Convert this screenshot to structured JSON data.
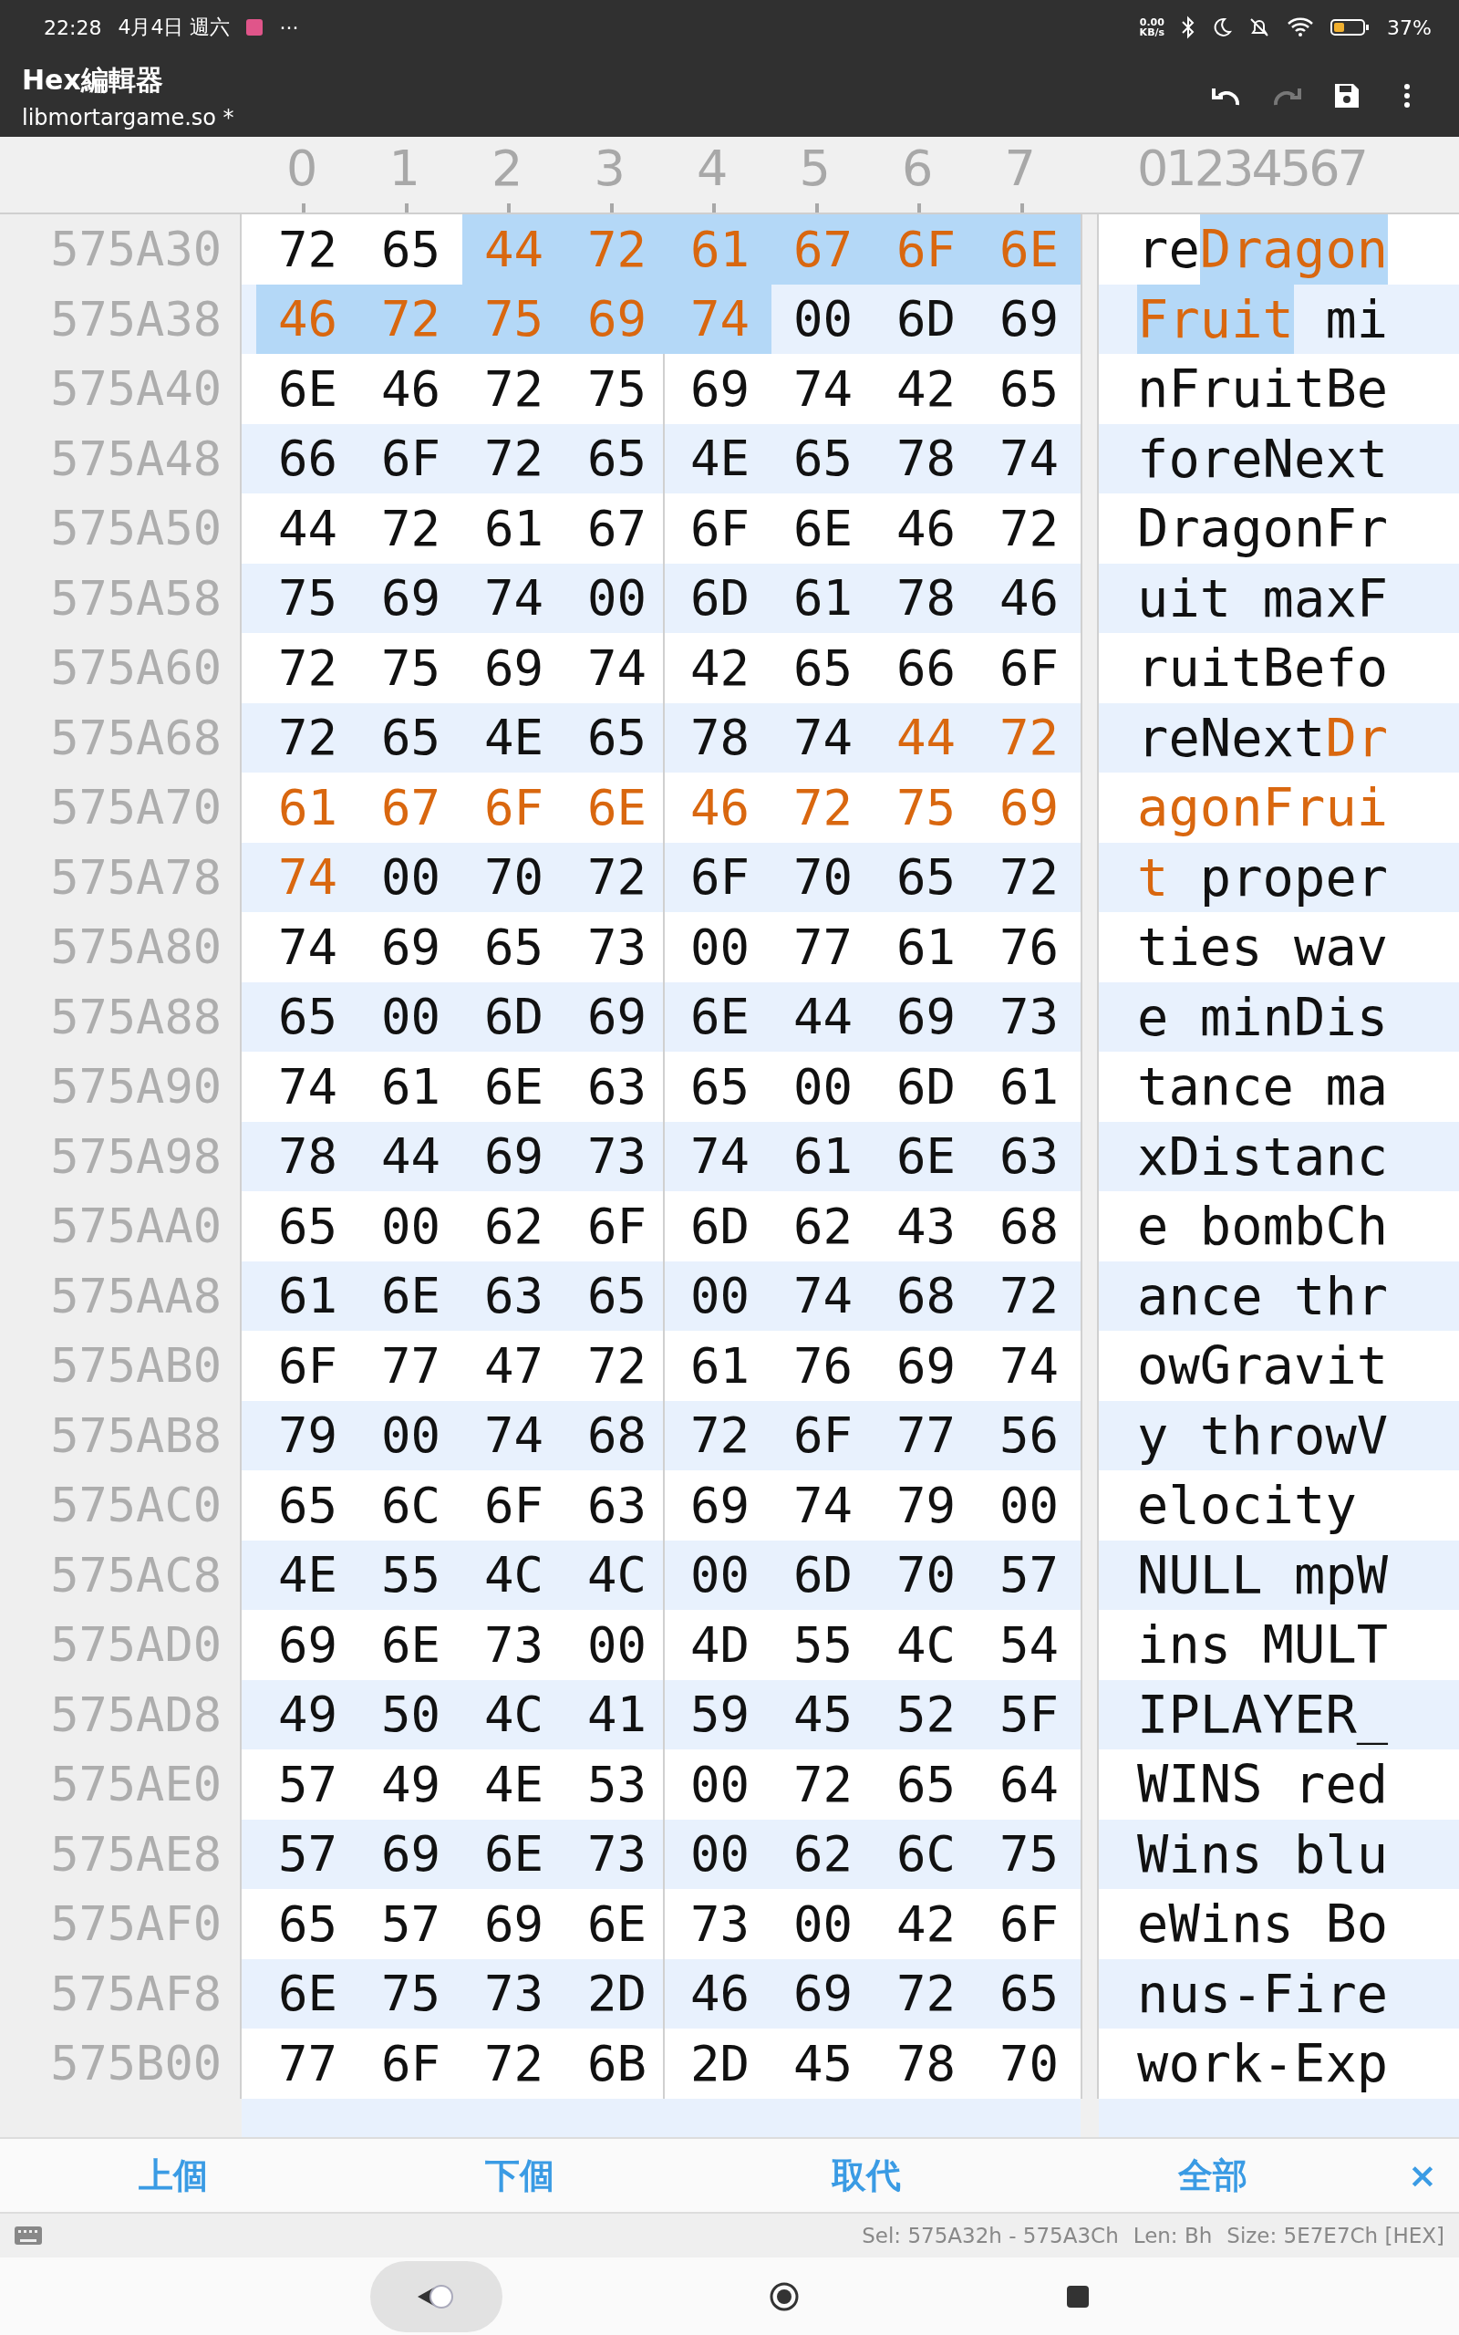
{
  "status_bar": {
    "time": "22:28",
    "date": "4月4日 週六",
    "more": "···",
    "speed": [
      "0.00",
      "KB/s"
    ],
    "battery": "37%"
  },
  "app_bar": {
    "title": "Hex編輯器",
    "subtitle": "libmortargame.so *",
    "redo_disabled": true
  },
  "header": {
    "columns": [
      "0",
      "1",
      "2",
      "3",
      "4",
      "5",
      "6",
      "7"
    ],
    "ascii": "01234567"
  },
  "rows": [
    {
      "offset": "575A30",
      "ascii": "reDragon",
      "bytes": [
        {
          "hex": "72",
          "match": false,
          "selected": false
        },
        {
          "hex": "65",
          "match": false,
          "selected": false
        },
        {
          "hex": "44",
          "match": true,
          "selected": true
        },
        {
          "hex": "72",
          "match": true,
          "selected": true
        },
        {
          "hex": "61",
          "match": true,
          "selected": true
        },
        {
          "hex": "67",
          "match": true,
          "selected": true
        },
        {
          "hex": "6F",
          "match": true,
          "selected": true
        },
        {
          "hex": "6E",
          "match": true,
          "selected": true
        }
      ]
    },
    {
      "offset": "575A38",
      "ascii": "Fruit mi",
      "bytes": [
        {
          "hex": "46",
          "match": true,
          "selected": true
        },
        {
          "hex": "72",
          "match": true,
          "selected": true
        },
        {
          "hex": "75",
          "match": true,
          "selected": true
        },
        {
          "hex": "69",
          "match": true,
          "selected": true
        },
        {
          "hex": "74",
          "match": true,
          "selected": true
        },
        {
          "hex": "00",
          "match": false,
          "selected": false
        },
        {
          "hex": "6D",
          "match": false,
          "selected": false
        },
        {
          "hex": "69",
          "match": false,
          "selected": false
        }
      ]
    },
    {
      "offset": "575A40",
      "ascii": "nFruitBe",
      "bytes": [
        {
          "hex": "6E",
          "match": false,
          "selected": false
        },
        {
          "hex": "46",
          "match": false,
          "selected": false
        },
        {
          "hex": "72",
          "match": false,
          "selected": false
        },
        {
          "hex": "75",
          "match": false,
          "selected": false
        },
        {
          "hex": "69",
          "match": false,
          "selected": false
        },
        {
          "hex": "74",
          "match": false,
          "selected": false
        },
        {
          "hex": "42",
          "match": false,
          "selected": false
        },
        {
          "hex": "65",
          "match": false,
          "selected": false
        }
      ]
    },
    {
      "offset": "575A48",
      "ascii": "foreNext",
      "bytes": [
        {
          "hex": "66",
          "match": false,
          "selected": false
        },
        {
          "hex": "6F",
          "match": false,
          "selected": false
        },
        {
          "hex": "72",
          "match": false,
          "selected": false
        },
        {
          "hex": "65",
          "match": false,
          "selected": false
        },
        {
          "hex": "4E",
          "match": false,
          "selected": false
        },
        {
          "hex": "65",
          "match": false,
          "selected": false
        },
        {
          "hex": "78",
          "match": false,
          "selected": false
        },
        {
          "hex": "74",
          "match": false,
          "selected": false
        }
      ]
    },
    {
      "offset": "575A50",
      "ascii": "DragonFr",
      "bytes": [
        {
          "hex": "44",
          "match": false,
          "selected": false
        },
        {
          "hex": "72",
          "match": false,
          "selected": false
        },
        {
          "hex": "61",
          "match": false,
          "selected": false
        },
        {
          "hex": "67",
          "match": false,
          "selected": false
        },
        {
          "hex": "6F",
          "match": false,
          "selected": false
        },
        {
          "hex": "6E",
          "match": false,
          "selected": false
        },
        {
          "hex": "46",
          "match": false,
          "selected": false
        },
        {
          "hex": "72",
          "match": false,
          "selected": false
        }
      ]
    },
    {
      "offset": "575A58",
      "ascii": "uit maxF",
      "bytes": [
        {
          "hex": "75",
          "match": false,
          "selected": false
        },
        {
          "hex": "69",
          "match": false,
          "selected": false
        },
        {
          "hex": "74",
          "match": false,
          "selected": false
        },
        {
          "hex": "00",
          "match": false,
          "selected": false
        },
        {
          "hex": "6D",
          "match": false,
          "selected": false
        },
        {
          "hex": "61",
          "match": false,
          "selected": false
        },
        {
          "hex": "78",
          "match": false,
          "selected": false
        },
        {
          "hex": "46",
          "match": false,
          "selected": false
        }
      ]
    },
    {
      "offset": "575A60",
      "ascii": "ruitBefo",
      "bytes": [
        {
          "hex": "72",
          "match": false,
          "selected": false
        },
        {
          "hex": "75",
          "match": false,
          "selected": false
        },
        {
          "hex": "69",
          "match": false,
          "selected": false
        },
        {
          "hex": "74",
          "match": false,
          "selected": false
        },
        {
          "hex": "42",
          "match": false,
          "selected": false
        },
        {
          "hex": "65",
          "match": false,
          "selected": false
        },
        {
          "hex": "66",
          "match": false,
          "selected": false
        },
        {
          "hex": "6F",
          "match": false,
          "selected": false
        }
      ]
    },
    {
      "offset": "575A68",
      "ascii": "reNextDr",
      "bytes": [
        {
          "hex": "72",
          "match": false,
          "selected": false
        },
        {
          "hex": "65",
          "match": false,
          "selected": false
        },
        {
          "hex": "4E",
          "match": false,
          "selected": false
        },
        {
          "hex": "65",
          "match": false,
          "selected": false
        },
        {
          "hex": "78",
          "match": false,
          "selected": false
        },
        {
          "hex": "74",
          "match": false,
          "selected": false
        },
        {
          "hex": "44",
          "match": true,
          "selected": false
        },
        {
          "hex": "72",
          "match": true,
          "selected": false
        }
      ]
    },
    {
      "offset": "575A70",
      "ascii": "agonFrui",
      "bytes": [
        {
          "hex": "61",
          "match": true,
          "selected": false
        },
        {
          "hex": "67",
          "match": true,
          "selected": false
        },
        {
          "hex": "6F",
          "match": true,
          "selected": false
        },
        {
          "hex": "6E",
          "match": true,
          "selected": false
        },
        {
          "hex": "46",
          "match": true,
          "selected": false
        },
        {
          "hex": "72",
          "match": true,
          "selected": false
        },
        {
          "hex": "75",
          "match": true,
          "selected": false
        },
        {
          "hex": "69",
          "match": true,
          "selected": false
        }
      ]
    },
    {
      "offset": "575A78",
      "ascii": "t proper",
      "bytes": [
        {
          "hex": "74",
          "match": true,
          "selected": false
        },
        {
          "hex": "00",
          "match": false,
          "selected": false
        },
        {
          "hex": "70",
          "match": false,
          "selected": false
        },
        {
          "hex": "72",
          "match": false,
          "selected": false
        },
        {
          "hex": "6F",
          "match": false,
          "selected": false
        },
        {
          "hex": "70",
          "match": false,
          "selected": false
        },
        {
          "hex": "65",
          "match": false,
          "selected": false
        },
        {
          "hex": "72",
          "match": false,
          "selected": false
        }
      ]
    },
    {
      "offset": "575A80",
      "ascii": "ties wav",
      "bytes": [
        {
          "hex": "74",
          "match": false,
          "selected": false
        },
        {
          "hex": "69",
          "match": false,
          "selected": false
        },
        {
          "hex": "65",
          "match": false,
          "selected": false
        },
        {
          "hex": "73",
          "match": false,
          "selected": false
        },
        {
          "hex": "00",
          "match": false,
          "selected": false
        },
        {
          "hex": "77",
          "match": false,
          "selected": false
        },
        {
          "hex": "61",
          "match": false,
          "selected": false
        },
        {
          "hex": "76",
          "match": false,
          "selected": false
        }
      ]
    },
    {
      "offset": "575A88",
      "ascii": "e minDis",
      "bytes": [
        {
          "hex": "65",
          "match": false,
          "selected": false
        },
        {
          "hex": "00",
          "match": false,
          "selected": false
        },
        {
          "hex": "6D",
          "match": false,
          "selected": false
        },
        {
          "hex": "69",
          "match": false,
          "selected": false
        },
        {
          "hex": "6E",
          "match": false,
          "selected": false
        },
        {
          "hex": "44",
          "match": false,
          "selected": false
        },
        {
          "hex": "69",
          "match": false,
          "selected": false
        },
        {
          "hex": "73",
          "match": false,
          "selected": false
        }
      ]
    },
    {
      "offset": "575A90",
      "ascii": "tance ma",
      "bytes": [
        {
          "hex": "74",
          "match": false,
          "selected": false
        },
        {
          "hex": "61",
          "match": false,
          "selected": false
        },
        {
          "hex": "6E",
          "match": false,
          "selected": false
        },
        {
          "hex": "63",
          "match": false,
          "selected": false
        },
        {
          "hex": "65",
          "match": false,
          "selected": false
        },
        {
          "hex": "00",
          "match": false,
          "selected": false
        },
        {
          "hex": "6D",
          "match": false,
          "selected": false
        },
        {
          "hex": "61",
          "match": false,
          "selected": false
        }
      ]
    },
    {
      "offset": "575A98",
      "ascii": "xDistanc",
      "bytes": [
        {
          "hex": "78",
          "match": false,
          "selected": false
        },
        {
          "hex": "44",
          "match": false,
          "selected": false
        },
        {
          "hex": "69",
          "match": false,
          "selected": false
        },
        {
          "hex": "73",
          "match": false,
          "selected": false
        },
        {
          "hex": "74",
          "match": false,
          "selected": false
        },
        {
          "hex": "61",
          "match": false,
          "selected": false
        },
        {
          "hex": "6E",
          "match": false,
          "selected": false
        },
        {
          "hex": "63",
          "match": false,
          "selected": false
        }
      ]
    },
    {
      "offset": "575AA0",
      "ascii": "e bombCh",
      "bytes": [
        {
          "hex": "65",
          "match": false,
          "selected": false
        },
        {
          "hex": "00",
          "match": false,
          "selected": false
        },
        {
          "hex": "62",
          "match": false,
          "selected": false
        },
        {
          "hex": "6F",
          "match": false,
          "selected": false
        },
        {
          "hex": "6D",
          "match": false,
          "selected": false
        },
        {
          "hex": "62",
          "match": false,
          "selected": false
        },
        {
          "hex": "43",
          "match": false,
          "selected": false
        },
        {
          "hex": "68",
          "match": false,
          "selected": false
        }
      ]
    },
    {
      "offset": "575AA8",
      "ascii": "ance thr",
      "bytes": [
        {
          "hex": "61",
          "match": false,
          "selected": false
        },
        {
          "hex": "6E",
          "match": false,
          "selected": false
        },
        {
          "hex": "63",
          "match": false,
          "selected": false
        },
        {
          "hex": "65",
          "match": false,
          "selected": false
        },
        {
          "hex": "00",
          "match": false,
          "selected": false
        },
        {
          "hex": "74",
          "match": false,
          "selected": false
        },
        {
          "hex": "68",
          "match": false,
          "selected": false
        },
        {
          "hex": "72",
          "match": false,
          "selected": false
        }
      ]
    },
    {
      "offset": "575AB0",
      "ascii": "owGravit",
      "bytes": [
        {
          "hex": "6F",
          "match": false,
          "selected": false
        },
        {
          "hex": "77",
          "match": false,
          "selected": false
        },
        {
          "hex": "47",
          "match": false,
          "selected": false
        },
        {
          "hex": "72",
          "match": false,
          "selected": false
        },
        {
          "hex": "61",
          "match": false,
          "selected": false
        },
        {
          "hex": "76",
          "match": false,
          "selected": false
        },
        {
          "hex": "69",
          "match": false,
          "selected": false
        },
        {
          "hex": "74",
          "match": false,
          "selected": false
        }
      ]
    },
    {
      "offset": "575AB8",
      "ascii": "y throwV",
      "bytes": [
        {
          "hex": "79",
          "match": false,
          "selected": false
        },
        {
          "hex": "00",
          "match": false,
          "selected": false
        },
        {
          "hex": "74",
          "match": false,
          "selected": false
        },
        {
          "hex": "68",
          "match": false,
          "selected": false
        },
        {
          "hex": "72",
          "match": false,
          "selected": false
        },
        {
          "hex": "6F",
          "match": false,
          "selected": false
        },
        {
          "hex": "77",
          "match": false,
          "selected": false
        },
        {
          "hex": "56",
          "match": false,
          "selected": false
        }
      ]
    },
    {
      "offset": "575AC0",
      "ascii": "elocity ",
      "bytes": [
        {
          "hex": "65",
          "match": false,
          "selected": false
        },
        {
          "hex": "6C",
          "match": false,
          "selected": false
        },
        {
          "hex": "6F",
          "match": false,
          "selected": false
        },
        {
          "hex": "63",
          "match": false,
          "selected": false
        },
        {
          "hex": "69",
          "match": false,
          "selected": false
        },
        {
          "hex": "74",
          "match": false,
          "selected": false
        },
        {
          "hex": "79",
          "match": false,
          "selected": false
        },
        {
          "hex": "00",
          "match": false,
          "selected": false
        }
      ]
    },
    {
      "offset": "575AC8",
      "ascii": "NULL mpW",
      "bytes": [
        {
          "hex": "4E",
          "match": false,
          "selected": false
        },
        {
          "hex": "55",
          "match": false,
          "selected": false
        },
        {
          "hex": "4C",
          "match": false,
          "selected": false
        },
        {
          "hex": "4C",
          "match": false,
          "selected": false
        },
        {
          "hex": "00",
          "match": false,
          "selected": false
        },
        {
          "hex": "6D",
          "match": false,
          "selected": false
        },
        {
          "hex": "70",
          "match": false,
          "selected": false
        },
        {
          "hex": "57",
          "match": false,
          "selected": false
        }
      ]
    },
    {
      "offset": "575AD0",
      "ascii": "ins MULT",
      "bytes": [
        {
          "hex": "69",
          "match": false,
          "selected": false
        },
        {
          "hex": "6E",
          "match": false,
          "selected": false
        },
        {
          "hex": "73",
          "match": false,
          "selected": false
        },
        {
          "hex": "00",
          "match": false,
          "selected": false
        },
        {
          "hex": "4D",
          "match": false,
          "selected": false
        },
        {
          "hex": "55",
          "match": false,
          "selected": false
        },
        {
          "hex": "4C",
          "match": false,
          "selected": false
        },
        {
          "hex": "54",
          "match": false,
          "selected": false
        }
      ]
    },
    {
      "offset": "575AD8",
      "ascii": "IPLAYER_",
      "bytes": [
        {
          "hex": "49",
          "match": false,
          "selected": false
        },
        {
          "hex": "50",
          "match": false,
          "selected": false
        },
        {
          "hex": "4C",
          "match": false,
          "selected": false
        },
        {
          "hex": "41",
          "match": false,
          "selected": false
        },
        {
          "hex": "59",
          "match": false,
          "selected": false
        },
        {
          "hex": "45",
          "match": false,
          "selected": false
        },
        {
          "hex": "52",
          "match": false,
          "selected": false
        },
        {
          "hex": "5F",
          "match": false,
          "selected": false
        }
      ]
    },
    {
      "offset": "575AE0",
      "ascii": "WINS red",
      "bytes": [
        {
          "hex": "57",
          "match": false,
          "selected": false
        },
        {
          "hex": "49",
          "match": false,
          "selected": false
        },
        {
          "hex": "4E",
          "match": false,
          "selected": false
        },
        {
          "hex": "53",
          "match": false,
          "selected": false
        },
        {
          "hex": "00",
          "match": false,
          "selected": false
        },
        {
          "hex": "72",
          "match": false,
          "selected": false
        },
        {
          "hex": "65",
          "match": false,
          "selected": false
        },
        {
          "hex": "64",
          "match": false,
          "selected": false
        }
      ]
    },
    {
      "offset": "575AE8",
      "ascii": "Wins blu",
      "bytes": [
        {
          "hex": "57",
          "match": false,
          "selected": false
        },
        {
          "hex": "69",
          "match": false,
          "selected": false
        },
        {
          "hex": "6E",
          "match": false,
          "selected": false
        },
        {
          "hex": "73",
          "match": false,
          "selected": false
        },
        {
          "hex": "00",
          "match": false,
          "selected": false
        },
        {
          "hex": "62",
          "match": false,
          "selected": false
        },
        {
          "hex": "6C",
          "match": false,
          "selected": false
        },
        {
          "hex": "75",
          "match": false,
          "selected": false
        }
      ]
    },
    {
      "offset": "575AF0",
      "ascii": "eWins Bo",
      "bytes": [
        {
          "hex": "65",
          "match": false,
          "selected": false
        },
        {
          "hex": "57",
          "match": false,
          "selected": false
        },
        {
          "hex": "69",
          "match": false,
          "selected": false
        },
        {
          "hex": "6E",
          "match": false,
          "selected": false
        },
        {
          "hex": "73",
          "match": false,
          "selected": false
        },
        {
          "hex": "00",
          "match": false,
          "selected": false
        },
        {
          "hex": "42",
          "match": false,
          "selected": false
        },
        {
          "hex": "6F",
          "match": false,
          "selected": false
        }
      ]
    },
    {
      "offset": "575AF8",
      "ascii": "nus-Fire",
      "bytes": [
        {
          "hex": "6E",
          "match": false,
          "selected": false
        },
        {
          "hex": "75",
          "match": false,
          "selected": false
        },
        {
          "hex": "73",
          "match": false,
          "selected": false
        },
        {
          "hex": "2D",
          "match": false,
          "selected": false
        },
        {
          "hex": "46",
          "match": false,
          "selected": false
        },
        {
          "hex": "69",
          "match": false,
          "selected": false
        },
        {
          "hex": "72",
          "match": false,
          "selected": false
        },
        {
          "hex": "65",
          "match": false,
          "selected": false
        }
      ]
    },
    {
      "offset": "575B00",
      "ascii": "work-Exp",
      "bytes": [
        {
          "hex": "77",
          "match": false,
          "selected": false
        },
        {
          "hex": "6F",
          "match": false,
          "selected": false
        },
        {
          "hex": "72",
          "match": false,
          "selected": false
        },
        {
          "hex": "6B",
          "match": false,
          "selected": false
        },
        {
          "hex": "2D",
          "match": false,
          "selected": false
        },
        {
          "hex": "45",
          "match": false,
          "selected": false
        },
        {
          "hex": "78",
          "match": false,
          "selected": false
        },
        {
          "hex": "70",
          "match": false,
          "selected": false
        }
      ]
    }
  ],
  "find_bar": {
    "buttons": [
      "上個",
      "下個",
      "取代",
      "全部"
    ],
    "close": "×"
  },
  "info_bar": {
    "selection": "Sel: 575A32h - 575A3Ch",
    "length": "Len: Bh",
    "size": "Size: 5E7E7Ch [HEX]"
  }
}
